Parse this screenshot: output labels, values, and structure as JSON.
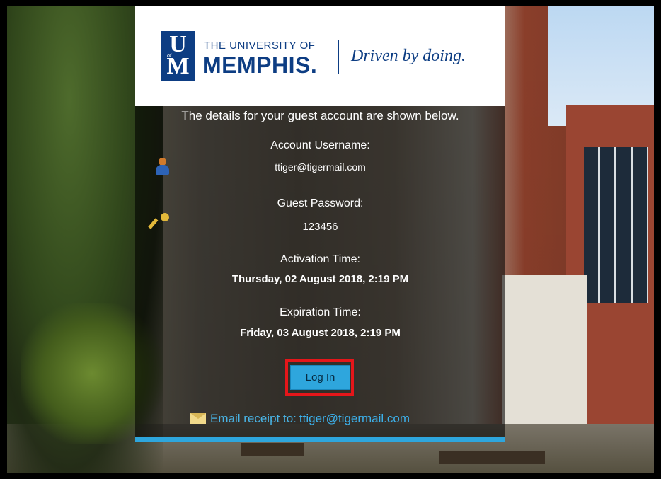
{
  "logo": {
    "mark_top": "U",
    "mark_bottom": "M",
    "mark_of": "of",
    "university_small": "THE UNIVERSITY OF",
    "university_big": "MEMPHIS.",
    "tagline": "Driven by doing."
  },
  "intro_text": "The details for your guest account are shown below.",
  "account": {
    "username_label": "Account Username:",
    "username_value": "ttiger@tigermail.com",
    "password_label": "Guest Password:",
    "password_value": "123456",
    "activation_label": "Activation Time:",
    "activation_value": "Thursday, 02 August 2018, 2:19 PM",
    "expiration_label": "Expiration Time:",
    "expiration_value": "Friday, 03 August 2018, 2:19 PM"
  },
  "login_button": "Log In",
  "email_receipt": {
    "label": "Email receipt to:",
    "address": "ttiger@tigermail.com"
  },
  "icons": {
    "user": "user-icon",
    "key": "key-icon",
    "envelope": "envelope-icon"
  },
  "colors": {
    "brand_blue": "#0d3d83",
    "button_blue": "#2ea6dd",
    "highlight_red": "#e5161a"
  }
}
